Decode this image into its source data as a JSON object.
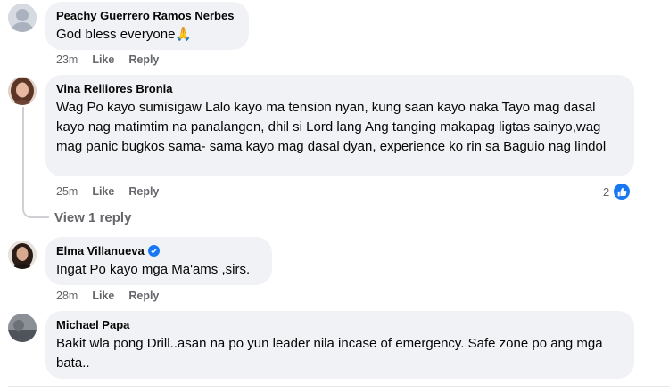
{
  "comments": [
    {
      "author": "Peachy Guerrero Ramos Nerbes",
      "text": "God bless everyone🙏",
      "time": "23m",
      "like_label": "Like",
      "reply_label": "Reply",
      "avatar_color": "#c9ced6"
    },
    {
      "author": "Vina Relliores Bronia",
      "text": "Wag Po kayo sumisigaw Lalo kayo ma tension nyan, kung saan kayo naka Tayo mag dasal kayo nag matimtim na panalangen, dhil si Lord lang Ang tanging makapag ligtas sainyo,wag mag panic bugkos sama- sama kayo mag dasal dyan, experience ko rin sa Baguio nag lindol",
      "time": "25m",
      "like_label": "Like",
      "reply_label": "Reply",
      "reaction_count": "2",
      "avatar_color": "#7a4b3a"
    },
    {
      "author": "Elma Villanueva",
      "text": "Ingat Po kayo mga Ma'ams ,sirs.",
      "time": "28m",
      "like_label": "Like",
      "reply_label": "Reply",
      "verified": true,
      "avatar_color": "#3b2a22"
    },
    {
      "author": "Michael Papa",
      "text": "Bakit wla pong Drill..asan na po yun leader nila incase of emergency. Safe zone po ang mga bata..",
      "avatar_color": "#5a5f66"
    }
  ],
  "view_replies_label": "View 1 reply",
  "colors": {
    "bubble": "#f0f2f5",
    "meta": "#65676b",
    "accent": "#1877f2"
  }
}
